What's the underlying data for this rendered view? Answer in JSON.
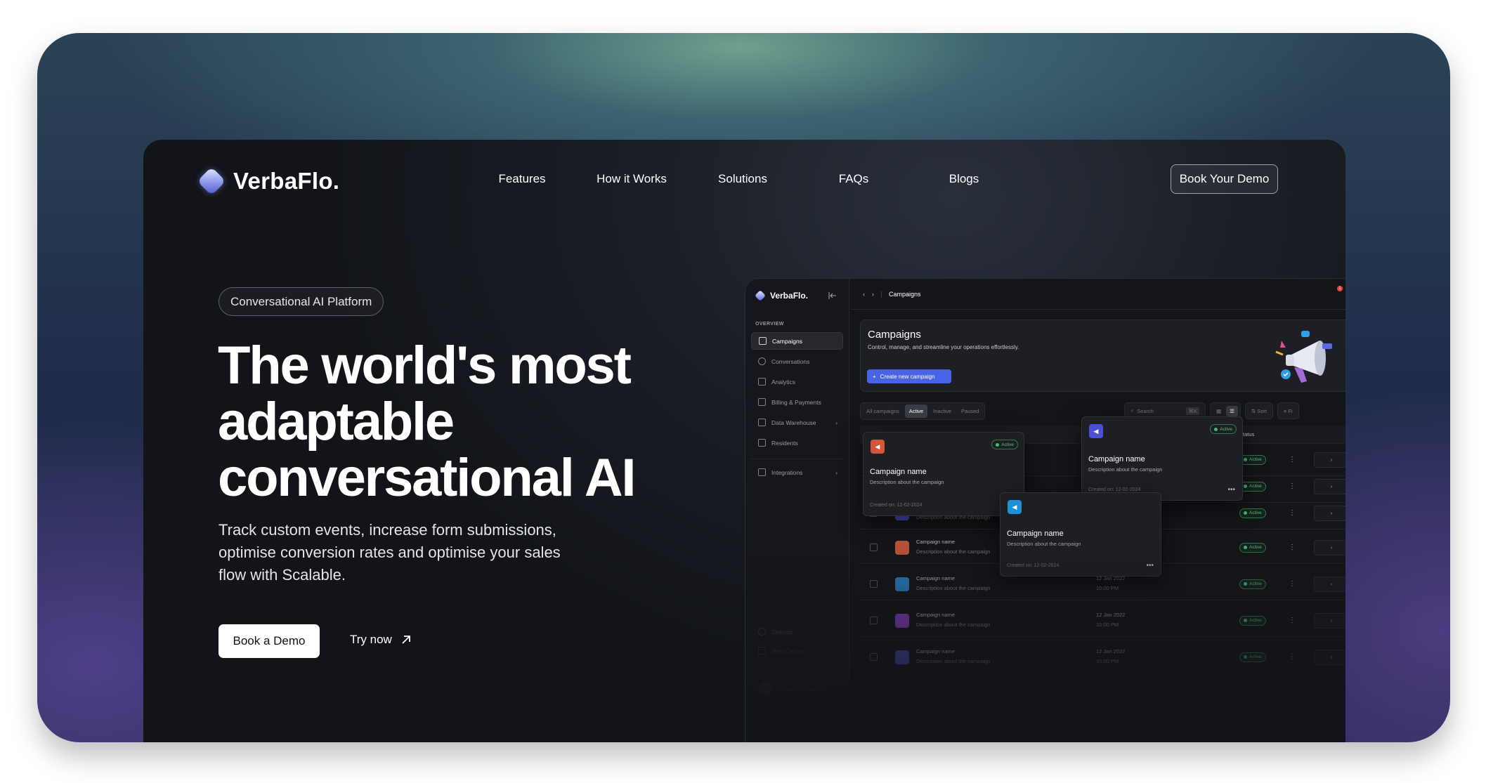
{
  "brand": "VerbaFlo.",
  "nav": {
    "items": [
      "Features",
      "How it Works",
      "Solutions",
      "FAQs",
      "Blogs"
    ],
    "cta": "Book Your Demo"
  },
  "hero": {
    "badge": "Conversational AI Platform",
    "headline": "The world's most adaptable conversational AI",
    "subtitle": "Track custom events, increase form submissions, optimise conversion rates and optimise your sales flow with Scalable.",
    "primary_cta": "Book a Demo",
    "secondary_cta": "Try now"
  },
  "dashboard": {
    "brand": "VerbaFlo.",
    "section": "OVERVIEW",
    "sidebar": [
      "Campaigns",
      "Conversations",
      "Analytics",
      "Billing & Payments",
      "Data Warehouse",
      "Residents",
      "Integrations"
    ],
    "sidebar_footer": [
      "Settings",
      "Help Centre"
    ],
    "user": "Priyanshu Gupta",
    "breadcrumb": "Campaigns",
    "notifications": "1",
    "campaigns_title": "Campaigns",
    "campaigns_desc": "Control, manage, and streamline your operations effortlessly.",
    "create_btn": "Create new campaign",
    "filters": [
      "All campaigns",
      "Active",
      "Inactive",
      "Paused"
    ],
    "search_placeholder": "Search",
    "search_shortcut": "⌘K",
    "sort": "Sort",
    "filter": "Fi",
    "status_header": "Status",
    "rows": [
      {
        "name": "Campaign name",
        "desc": "Description about the campaign",
        "date": "",
        "time": "",
        "status": "Active",
        "color": "#4b4fb8"
      },
      {
        "name": "Campaign name",
        "desc": "Description about the campaign",
        "date": "12 Jan 2022",
        "time": "10:00 PM",
        "status": "Active",
        "color": "#c4553a"
      },
      {
        "name": "Campaign name",
        "desc": "Description about the campaign",
        "date": "12 Jan 2022",
        "time": "10:00 PM",
        "status": "Active",
        "color": "#2a7fc0"
      },
      {
        "name": "Campaign name",
        "desc": "Description about the campaign",
        "date": "12 Jan 2022",
        "time": "10:00 PM",
        "status": "Active",
        "color": "#8a3fc0"
      },
      {
        "name": "Campaign name",
        "desc": "Description about the campaign",
        "date": "12 Jan 2022",
        "time": "10:00 PM",
        "status": "Active",
        "color": "#4b4fb8"
      }
    ],
    "cards": [
      {
        "name": "Campaign name",
        "desc": "Description about the campaign",
        "created": "Created on: 12-02-2024",
        "status": "Active",
        "color": "#d4553a"
      },
      {
        "name": "Campaign name",
        "desc": "Description about the campaign",
        "created": "Created on: 12-02-2024",
        "status": "Active",
        "color": "#4b4fd8"
      },
      {
        "name": "Campaign name",
        "desc": "Description about the campaign",
        "created": "Created on: 12-02-2024",
        "status": "",
        "color": "#1f8fd6"
      }
    ]
  }
}
